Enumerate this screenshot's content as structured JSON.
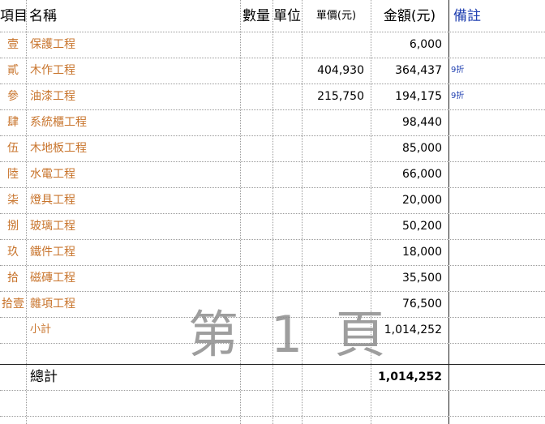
{
  "header": {
    "item": "項目",
    "name": "名稱",
    "quantity": "數量",
    "unit": "單位",
    "unit_price": "單價(元)",
    "amount": "金額(元)",
    "remarks": "備註"
  },
  "rows": [
    {
      "idx": "壹",
      "name": "保護工程",
      "unit_price": "",
      "amount": "6,000",
      "note": ""
    },
    {
      "idx": "貳",
      "name": "木作工程",
      "unit_price": "404,930",
      "amount": "364,437",
      "note": "9折"
    },
    {
      "idx": "參",
      "name": "油漆工程",
      "unit_price": "215,750",
      "amount": "194,175",
      "note": "9折"
    },
    {
      "idx": "肆",
      "name": "系統櫃工程",
      "unit_price": "",
      "amount": "98,440",
      "note": ""
    },
    {
      "idx": "伍",
      "name": "木地板工程",
      "unit_price": "",
      "amount": "85,000",
      "note": ""
    },
    {
      "idx": "陸",
      "name": "水電工程",
      "unit_price": "",
      "amount": "66,000",
      "note": ""
    },
    {
      "idx": "柒",
      "name": "燈具工程",
      "unit_price": "",
      "amount": "20,000",
      "note": ""
    },
    {
      "idx": "捌",
      "name": "玻璃工程",
      "unit_price": "",
      "amount": "50,200",
      "note": ""
    },
    {
      "idx": "玖",
      "name": "鐵件工程",
      "unit_price": "",
      "amount": "18,000",
      "note": ""
    },
    {
      "idx": "拾",
      "name": "磁磚工程",
      "unit_price": "",
      "amount": "35,500",
      "note": ""
    },
    {
      "idx": "拾壹",
      "name": "雜項工程",
      "unit_price": "",
      "amount": "76,500",
      "note": ""
    }
  ],
  "subtotal": {
    "label": "小計",
    "amount": "1,014,252"
  },
  "total": {
    "label": "總計",
    "amount": "1,014,252"
  },
  "watermark": "第 1 頁",
  "colors": {
    "item_text": "#c8742c",
    "remark_header": "#1f3fb0",
    "watermark": "#8e8e8e"
  }
}
